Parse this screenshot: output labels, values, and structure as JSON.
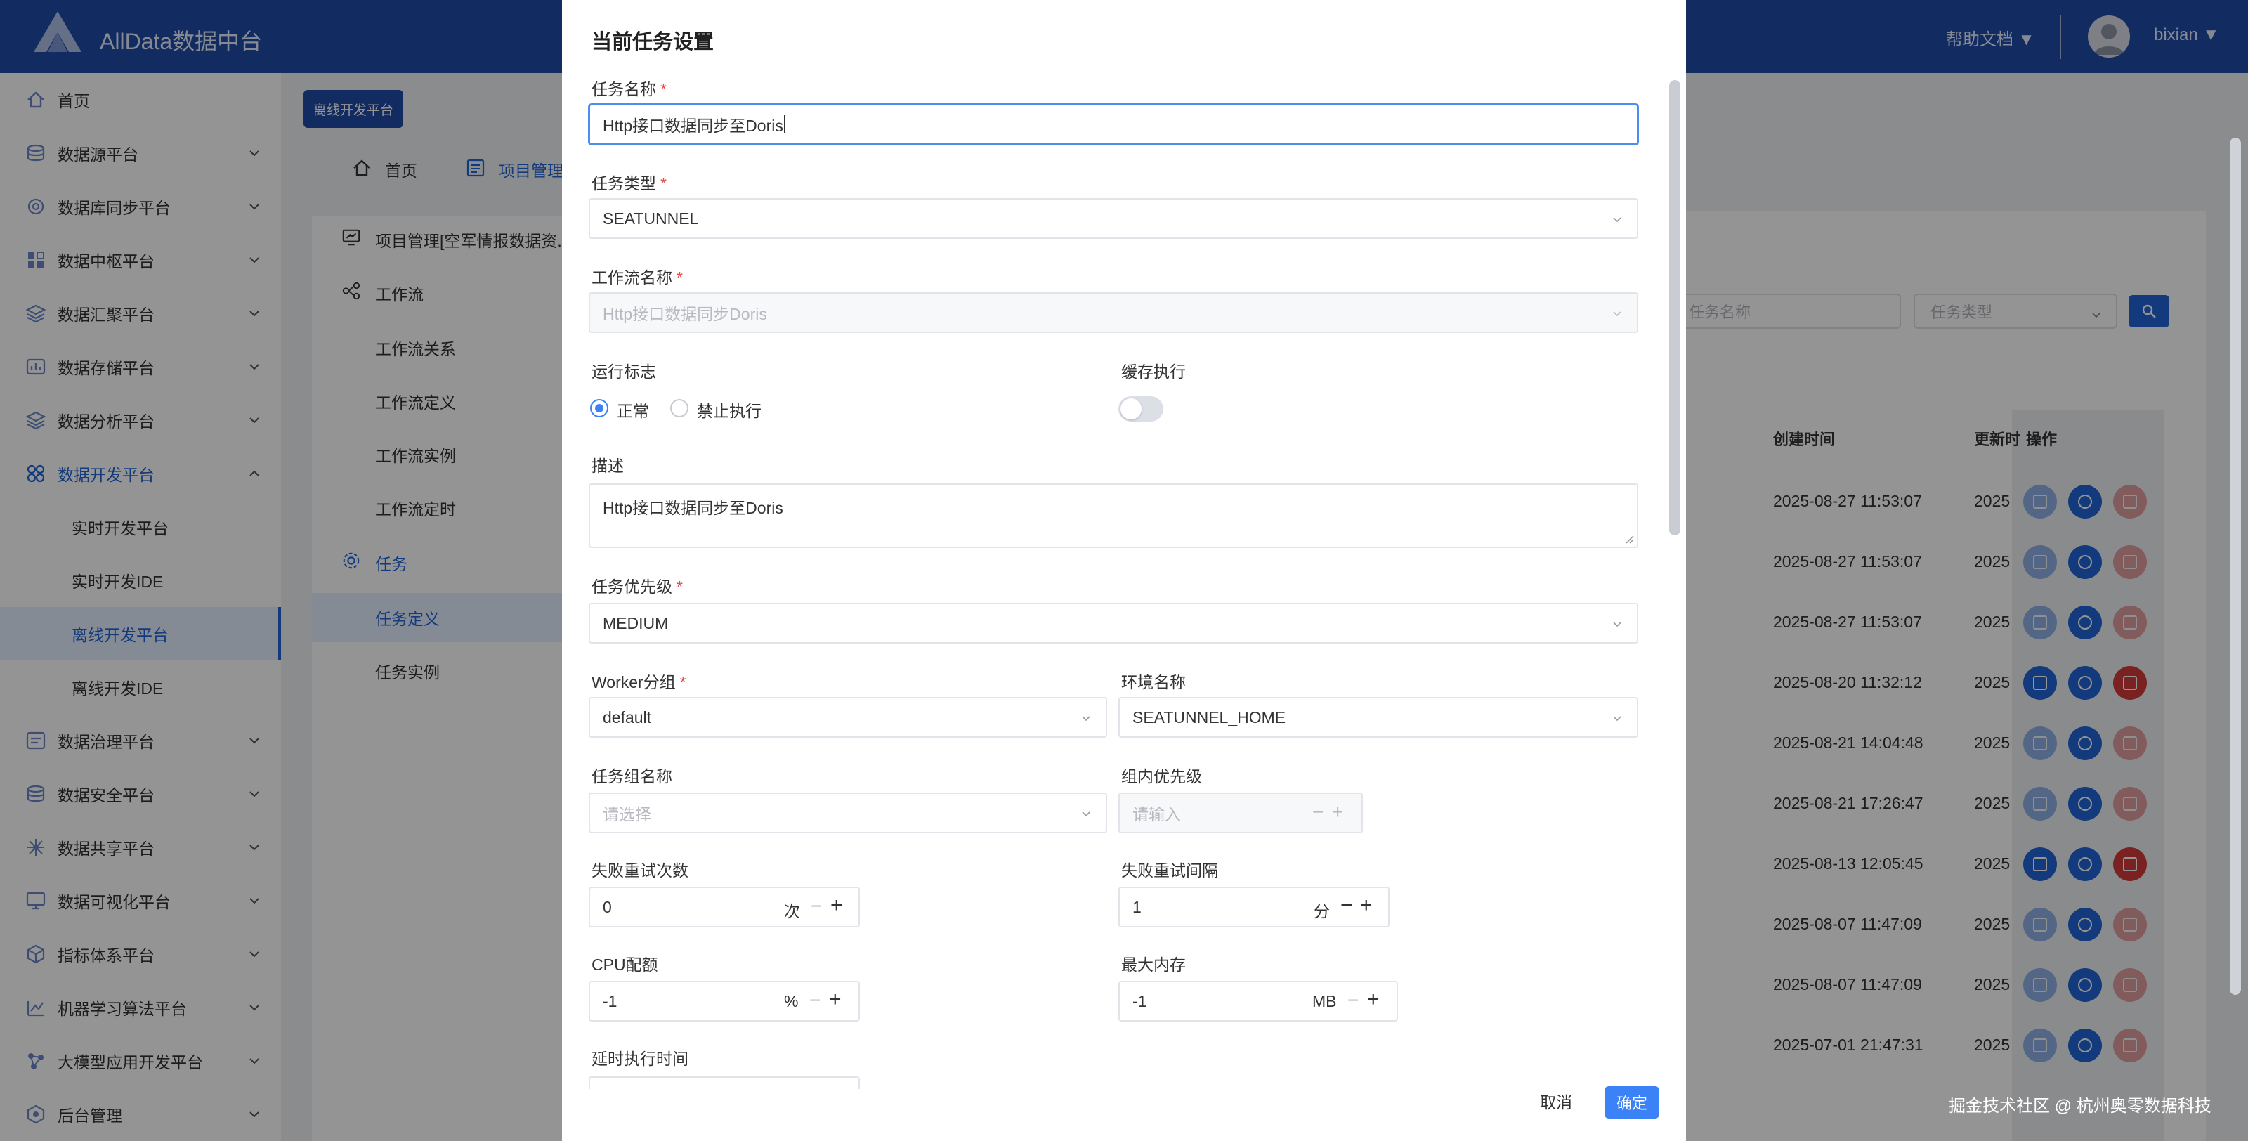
{
  "header": {
    "brand": "AllData数据中台",
    "help": "帮助文档 ▼",
    "user": "bixian ▼"
  },
  "sidebar": {
    "items": [
      {
        "label": "首页",
        "icon": "home-icon"
      },
      {
        "label": "数据源平台",
        "icon": "stack-icon"
      },
      {
        "label": "数据库同步平台",
        "icon": "sync-icon"
      },
      {
        "label": "数据中枢平台",
        "icon": "grid-icon"
      },
      {
        "label": "数据汇聚平台",
        "icon": "stack-icon"
      },
      {
        "label": "数据存储平台",
        "icon": "storage-icon"
      },
      {
        "label": "数据分析平台",
        "icon": "stack-icon"
      },
      {
        "label": "数据开发平台",
        "icon": "dev-icon"
      },
      {
        "label": "实时开发平台"
      },
      {
        "label": "实时开发IDE"
      },
      {
        "label": "离线开发平台"
      },
      {
        "label": "离线开发IDE"
      },
      {
        "label": "数据治理平台",
        "icon": "governance-icon"
      },
      {
        "label": "数据安全平台",
        "icon": "stack-icon"
      },
      {
        "label": "数据共享平台",
        "icon": "share-icon"
      },
      {
        "label": "数据可视化平台",
        "icon": "monitor-icon"
      },
      {
        "label": "指标体系平台",
        "icon": "cube-icon"
      },
      {
        "label": "机器学习算法平台",
        "icon": "ml-icon"
      },
      {
        "label": "大模型应用开发平台",
        "icon": "llm-icon"
      },
      {
        "label": "后台管理",
        "icon": "admin-icon"
      }
    ]
  },
  "main": {
    "tag_button": "离线开发平台",
    "breadcrumb": {
      "home": "首页",
      "project": "项目管理"
    },
    "tree": {
      "project": "项目管理[空军情报数据资...",
      "workflow": "工作流",
      "workflow_relation": "工作流关系",
      "workflow_definition": "工作流定义",
      "workflow_instance": "工作流实例",
      "workflow_timing": "工作流定时",
      "task": "任务",
      "task_definition": "任务定义",
      "task_instance": "任务实例"
    },
    "search": {
      "name_placeholder": "任务名称",
      "type_placeholder": "任务类型"
    },
    "table": {
      "headers": {
        "created": "创建时间",
        "updated": "更新时",
        "ops": "操作"
      },
      "rows": [
        {
          "created": "2025-08-27 11:53:07",
          "updated": "2025",
          "enabled": false
        },
        {
          "created": "2025-08-27 11:53:07",
          "updated": "2025",
          "enabled": false
        },
        {
          "created": "2025-08-27 11:53:07",
          "updated": "2025",
          "enabled": false
        },
        {
          "created": "2025-08-20 11:32:12",
          "updated": "2025",
          "enabled": true
        },
        {
          "created": "2025-08-21 14:04:48",
          "updated": "2025",
          "enabled": false
        },
        {
          "created": "2025-08-21 17:26:47",
          "updated": "2025",
          "enabled": false
        },
        {
          "created": "2025-08-13 12:05:45",
          "updated": "2025",
          "enabled": true
        },
        {
          "created": "2025-08-07 11:47:09",
          "updated": "2025",
          "enabled": false
        },
        {
          "created": "2025-08-07 11:47:09",
          "updated": "2025",
          "enabled": false
        },
        {
          "created": "2025-07-01 21:47:31",
          "updated": "2025",
          "enabled": false
        }
      ]
    }
  },
  "watermark": "掘金技术社区 @ 杭州奥零数据科技",
  "modal": {
    "title": "当前任务设置",
    "task_name": {
      "label": "任务名称",
      "value": "Http接口数据同步至Doris"
    },
    "task_type": {
      "label": "任务类型",
      "value": "SEATUNNEL"
    },
    "workflow_name": {
      "label": "工作流名称",
      "value": "Http接口数据同步Doris"
    },
    "run_flag": {
      "label": "运行标志",
      "option_normal": "正常",
      "option_disabled": "禁止执行"
    },
    "cache": {
      "label": "缓存执行"
    },
    "description": {
      "label": "描述",
      "value": "Http接口数据同步至Doris"
    },
    "priority": {
      "label": "任务优先级",
      "value": "MEDIUM"
    },
    "worker_group": {
      "label": "Worker分组",
      "value": "default"
    },
    "environment": {
      "label": "环境名称",
      "value": "SEATUNNEL_HOME"
    },
    "task_group": {
      "label": "任务组名称",
      "placeholder": "请选择"
    },
    "group_priority": {
      "label": "组内优先级",
      "placeholder": "请输入"
    },
    "retry_times": {
      "label": "失败重试次数",
      "value": "0",
      "unit": "次"
    },
    "retry_interval": {
      "label": "失败重试间隔",
      "value": "1",
      "unit": "分"
    },
    "cpu_quota": {
      "label": "CPU配额",
      "value": "-1",
      "unit": "%"
    },
    "max_memory": {
      "label": "最大内存",
      "value": "-1",
      "unit": "MB"
    },
    "delay_time": {
      "label": "延时执行时间"
    },
    "cancel": "取消",
    "ok": "确定"
  }
}
